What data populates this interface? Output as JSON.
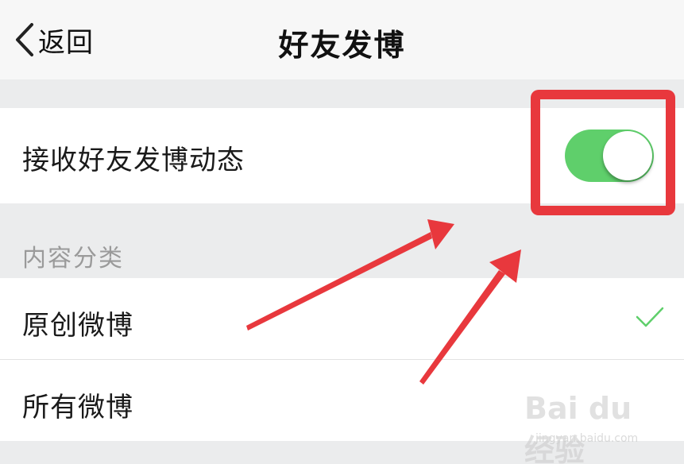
{
  "navbar": {
    "back_label": "返回",
    "title": "好友发博"
  },
  "settings": {
    "receive_toggle": {
      "label": "接收好友发博动态",
      "state": "on"
    },
    "content_section": {
      "header": "内容分类",
      "options": [
        {
          "label": "原创微博",
          "selected": true
        },
        {
          "label": "所有微博",
          "selected": false
        }
      ]
    }
  },
  "colors": {
    "toggle_on": "#5fcf6b",
    "check": "#5fcf6b",
    "annotation_red": "#e8383d"
  },
  "watermark": {
    "logo": "Bai du 经验",
    "url": "jingyan.baidu.com"
  }
}
